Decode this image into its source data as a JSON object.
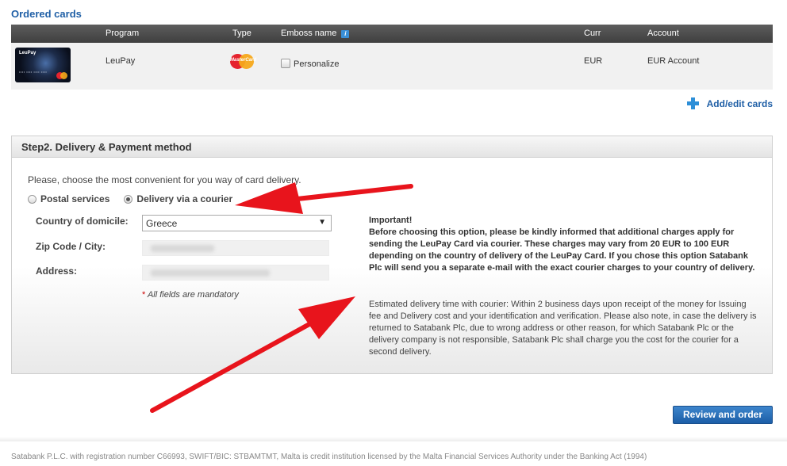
{
  "ordered_cards": {
    "title": "Ordered cards",
    "columns": {
      "program": "Program",
      "type": "Type",
      "emboss_name": "Emboss name",
      "curr": "Curr",
      "account": "Account"
    },
    "info_icon_glyph": "i",
    "rows": [
      {
        "card_brand": "LeuPay",
        "program": "LeuPay",
        "type_logo_text": "MasterCard",
        "personalize_label": "Personalize",
        "curr": "EUR",
        "account": "EUR Account"
      }
    ],
    "add_edit_label": "Add/edit cards"
  },
  "step2": {
    "title": "Step2. Delivery & Payment method",
    "intro": "Please, choose the most convenient for you way of card delivery.",
    "options": [
      {
        "label": "Postal services",
        "selected": false
      },
      {
        "label": "Delivery via a courier",
        "selected": true
      }
    ],
    "country_label": "Country of domicile:",
    "country_value": "Greece",
    "zip_label": "Zip Code / City:",
    "address_label": "Address:",
    "mandatory_star": "*",
    "mandatory_text": "All fields are mandatory",
    "important_text": "Important!\nBefore choosing this option, please be kindly informed that additional charges apply for sending the LeuPay Card via courier. These charges may vary from 20 EUR to 100 EUR depending on the country of delivery of the LeuPay Card. If you chose this option Satabank Plc will send you a separate e-mail with the exact courier charges to your country of delivery.",
    "estimate_text": "Estimated delivery time with courier: Within 2 business days upon receipt of the money for Issuing fee and Delivery cost and your identification and verification. Please also note, in case the delivery is returned to Satabank Plc, due to wrong address or other reason, for which Satabank Plc or the delivery company is not responsible, Satabank Plc shall charge you the cost for the courier for a second delivery."
  },
  "review_button": "Review and order",
  "footer": "Satabank P.L.C. with registration number C66993, SWIFT/BIC: STBAMTMT, Malta is credit institution licensed by the Malta Financial Services Authority under the Banking Act (1994)",
  "colors": {
    "link_blue": "#1f5fa6",
    "header_dark": "#4a4a4a",
    "annotation_red": "#e8141c",
    "button_blue": "#2b6fb8"
  }
}
